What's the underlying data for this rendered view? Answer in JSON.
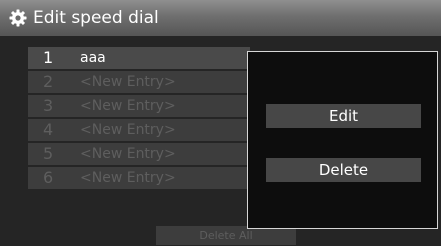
{
  "header": {
    "title": "Edit speed dial",
    "icon": "gear-icon"
  },
  "speed_dial": {
    "entries": [
      {
        "number": "1",
        "name": "aaa",
        "active": true
      },
      {
        "number": "2",
        "name": "<New Entry>",
        "active": false
      },
      {
        "number": "3",
        "name": "<New Entry>",
        "active": false
      },
      {
        "number": "4",
        "name": "<New Entry>",
        "active": false
      },
      {
        "number": "5",
        "name": "<New Entry>",
        "active": false
      },
      {
        "number": "6",
        "name": "<New Entry>",
        "active": false
      }
    ],
    "delete_all_label": "Delete All"
  },
  "popup_menu": {
    "edit_label": "Edit",
    "delete_label": "Delete"
  }
}
